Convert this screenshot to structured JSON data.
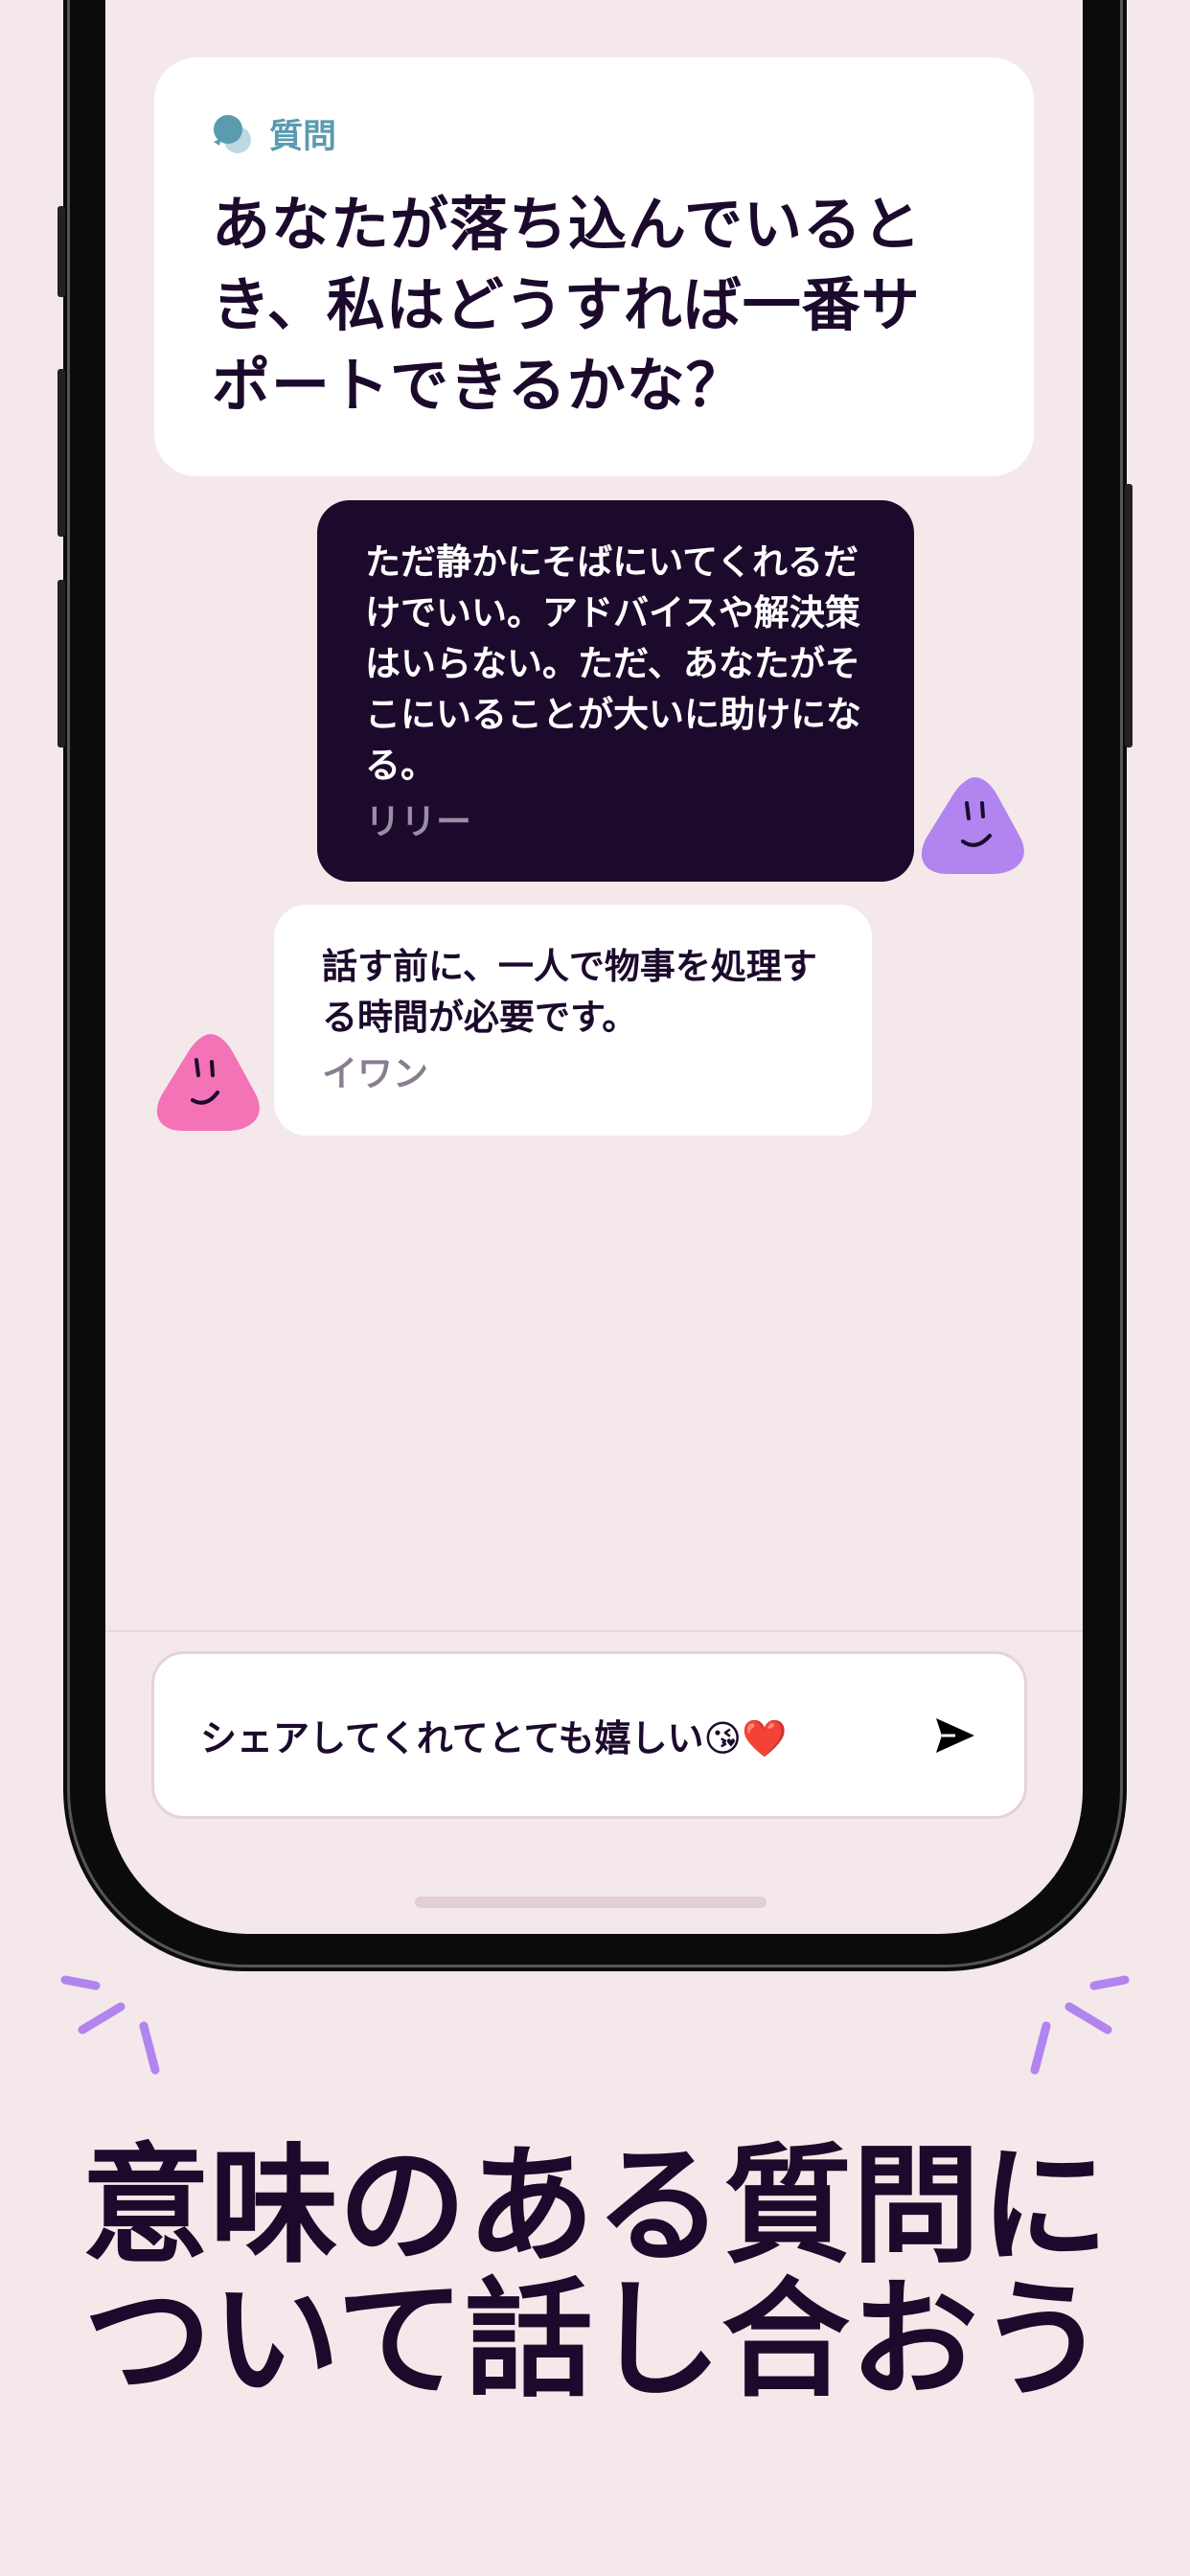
{
  "question_card": {
    "label": "質問",
    "text": "あなたが落ち込んでいるとき、私はどうすれば一番サポートできるかな？"
  },
  "messages": [
    {
      "text": "ただ静かにそばにいてくれるだけでいい。アドバイスや解決策はいらない。ただ、あなたがそこにいることが大いに助けになる。",
      "author": "リリー"
    },
    {
      "text": "話す前に、一人で物事を処理する時間が必要です。",
      "author": "イワン"
    }
  ],
  "input": {
    "value": "シェアしてくれてとても嬉しい😘❤️"
  },
  "headline": {
    "line1": "意味のある質問に",
    "line2": "ついて話し合おう"
  },
  "colors": {
    "background": "#f4e8ea",
    "dark": "#1c0a2c",
    "accent": "#5a9bb0",
    "purple": "#b184f0",
    "pink": "#f472b6"
  }
}
